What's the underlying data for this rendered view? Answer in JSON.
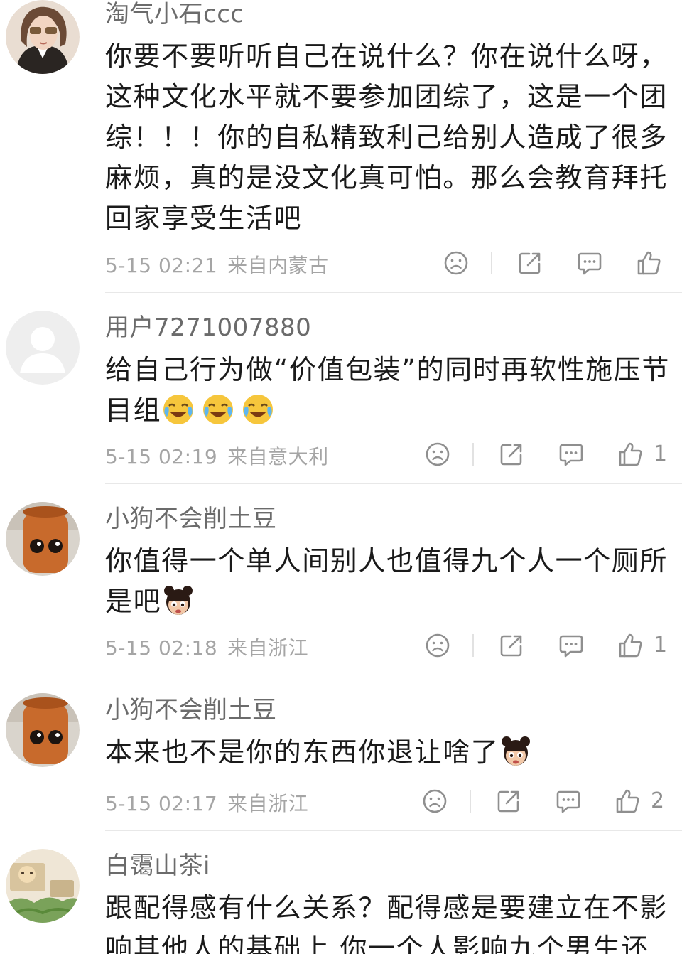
{
  "comments": [
    {
      "username": "淘气小石ccc",
      "text": "你要不要听听自己在说什么？你在说什么呀，这种文化水平就不要参加团综了，这是一个团综！！！你的自私精致利己给别人造成了很多麻烦，真的是没文化真可怕。那么会教育拜托回家享受生活吧",
      "emojis": [],
      "time": "5-15 02:21",
      "location": "来自内蒙古",
      "likes": ""
    },
    {
      "username": "用户7271007880",
      "text": "给自己行为做“价值包装”的同时再软性施压节目组",
      "emojis": [
        "laugh-cry-emoji",
        "laugh-cry-emoji",
        "laugh-cry-emoji"
      ],
      "time": "5-15 02:19",
      "location": "来自意大利",
      "likes": "1"
    },
    {
      "username": "小狗不会削土豆",
      "text": "你值得一个单人间别人也值得九个人一个厕所是吧",
      "emojis": [
        "girl-face-emoji"
      ],
      "time": "5-15 02:18",
      "location": "来自浙江",
      "likes": "1"
    },
    {
      "username": "小狗不会削土豆",
      "text": "本来也不是你的东西你退让啥了",
      "emojis": [
        "girl-face-emoji"
      ],
      "time": "5-15 02:17",
      "location": "来自浙江",
      "likes": "2"
    },
    {
      "username": "白霭山茶i",
      "text": "跟配得感有什么关系？配得感是要建立在不影响其他人的基础上 你一个人影响九个男生还",
      "emojis": [],
      "time": "",
      "location": "",
      "likes": ""
    }
  ],
  "icons": {
    "dislike": "sad-face-icon",
    "share": "share-icon",
    "reply": "comment-bubble-icon",
    "like": "thumbs-up-icon"
  },
  "colors": {
    "text": "#1a1a1a",
    "username": "#6b6b6b",
    "meta": "#a5a5a5",
    "icon": "#8f8f8f"
  }
}
